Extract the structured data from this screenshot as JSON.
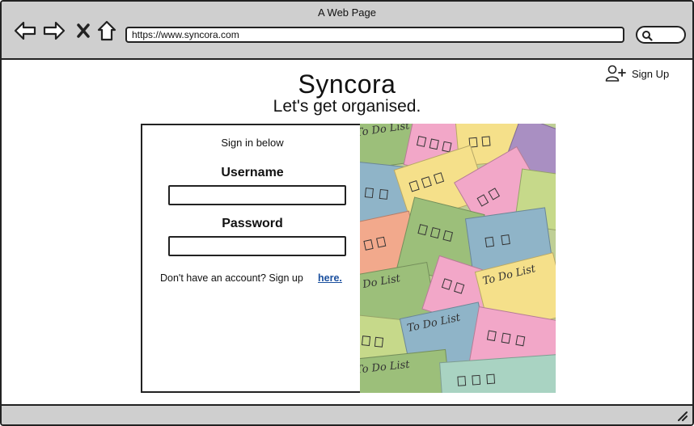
{
  "browser": {
    "title": "A Web Page",
    "url": "https://www.syncora.com",
    "icons": [
      "back-arrow-icon",
      "forward-arrow-icon",
      "close-x-icon",
      "home-icon",
      "search-icon"
    ]
  },
  "header": {
    "signup_label": "Sign Up",
    "signup_icon": "add-user-icon"
  },
  "hero": {
    "brand": "Syncora",
    "tagline": "Let's get organised."
  },
  "login": {
    "caption": "Sign in below",
    "username_label": "Username",
    "username_value": "",
    "password_label": "Password",
    "password_value": "",
    "no_account_text": "Don't have an account? Sign up",
    "signup_link": "here."
  },
  "image": {
    "note_text": "To Do List",
    "colors": [
      "#f2a7c8",
      "#9cbf7a",
      "#f5e08a",
      "#8fb4c8",
      "#f2a98c",
      "#a98fc2",
      "#c6d98a",
      "#e6c7a0"
    ]
  },
  "colors": {
    "chrome": "#cfcfcf",
    "link": "#1a4f9e",
    "border": "#222222"
  }
}
